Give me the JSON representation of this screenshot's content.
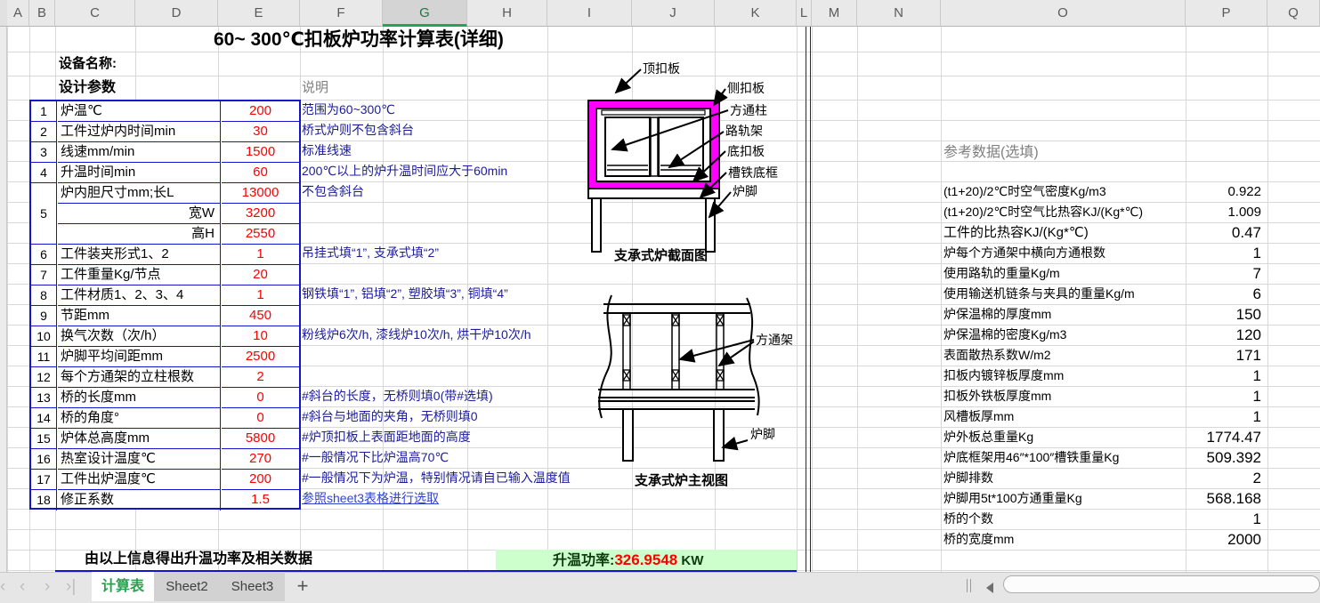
{
  "columns": [
    "A",
    "B",
    "C",
    "D",
    "E",
    "F",
    "G",
    "H",
    "I",
    "J",
    "K",
    "L",
    "M",
    "N",
    "O",
    "P",
    "Q"
  ],
  "selected_column": "G",
  "title": "60~ 300℃扣板炉功率计算表(详细)",
  "device_name_label": "设备名称:",
  "design_params_label": "设计参数",
  "desc_header": "说明",
  "params": {
    "rows": [
      {
        "num": "1",
        "label": "炉温℃",
        "value": "200",
        "desc": "范围为60~300℃"
      },
      {
        "num": "2",
        "label": "工件过炉内时间min",
        "value": "30",
        "desc": "桥式炉则不包含斜台"
      },
      {
        "num": "3",
        "label": "线速mm/min",
        "value": "1500",
        "desc": "标准线速"
      },
      {
        "num": "4",
        "label": "升温时间min",
        "value": "60",
        "desc": "200℃以上的炉升温时间应大于60min"
      },
      {
        "num": "5",
        "label": "炉内胆尺寸mm;长L",
        "value": "13000",
        "desc": "不包含斜台"
      },
      {
        "label": "宽W",
        "value": "3200"
      },
      {
        "label": "高H",
        "value": "2550"
      },
      {
        "num": "6",
        "label": "工件装夹形式1、2",
        "value": "1",
        "desc": "吊挂式填“1”, 支承式填“2”"
      },
      {
        "num": "7",
        "label": "工件重量Kg/节点",
        "value": "20",
        "desc": ""
      },
      {
        "num": "8",
        "label": "工件材质1、2、3、4",
        "value": "1",
        "desc": "钢铁填“1”, 铝填“2”, 塑胶填“3”, 铜填“4”"
      },
      {
        "num": "9",
        "label": "节距mm",
        "value": "450",
        "desc": ""
      },
      {
        "num": "10",
        "label": "换气次数（次/h）",
        "value": "10",
        "desc": "粉线炉6次/h, 漆线炉10次/h, 烘干炉10次/h"
      },
      {
        "num": "11",
        "label": "炉脚平均间距mm",
        "value": "2500",
        "desc": ""
      },
      {
        "num": "12",
        "label": "每个方通架的立柱根数",
        "value": "2",
        "desc": ""
      },
      {
        "num": "13",
        "label": "桥的长度mm",
        "value": "0",
        "desc": "#斜台的长度，无桥则填0(带#选填)"
      },
      {
        "num": "14",
        "label": "桥的角度°",
        "value": "0",
        "desc": "#斜台与地面的夹角，无桥则填0"
      },
      {
        "num": "15",
        "label": "炉体总高度mm",
        "value": "5800",
        "desc": "#炉顶扣板上表面距地面的高度"
      },
      {
        "num": "16",
        "label": "热室设计温度℃",
        "value": "270",
        "desc": "#一般情况下比炉温高70℃"
      },
      {
        "num": "17",
        "label": "工件出炉温度℃",
        "value": "200",
        "desc": "#一般情况下为炉温，特别情况请自已输入温度值"
      },
      {
        "num": "18",
        "label": "修正系数",
        "value": "1.5",
        "desc_link": "参照sheet3表格进行选取"
      }
    ]
  },
  "diagram1": {
    "caption": "支承式炉截面图",
    "labels": {
      "top_plate": "顶扣板",
      "side_plate": "侧扣板",
      "square_column": "方通柱",
      "rail_frame": "路轨架",
      "bottom_plate": "底扣板",
      "channel_base": "槽铁底框",
      "furnace_foot": "炉脚"
    }
  },
  "diagram2": {
    "caption": "支承式炉主视图",
    "labels": {
      "square_frame": "方通架",
      "furnace_foot": "炉脚"
    }
  },
  "reference": {
    "header": "参考数据(选填)",
    "rows": [
      {
        "label": "(t1+20)/2℃时空气密度Kg/m3",
        "value": "0.922"
      },
      {
        "label": "(t1+20)/2℃时空气比热容KJ/(Kg*℃)",
        "value": "1.009"
      },
      {
        "label": "工件的比热容KJ/(Kg*℃)",
        "value": "0.47"
      },
      {
        "label": "炉每个方通架中横向方通根数",
        "value": "1"
      },
      {
        "label": "使用路轨的重量Kg/m",
        "value": "7"
      },
      {
        "label": "使用输送机链条与夹具的重量Kg/m",
        "value": "6"
      },
      {
        "label": "炉保温棉的厚度mm",
        "value": "150"
      },
      {
        "label": "炉保温棉的密度Kg/m3",
        "value": "120"
      },
      {
        "label": "表面散热系数W/m2",
        "value": "171"
      },
      {
        "label": "扣板内镀锌板厚度mm",
        "value": "1"
      },
      {
        "label": "扣板外铁板厚度mm",
        "value": "1"
      },
      {
        "label": "风槽板厚mm",
        "value": "1"
      },
      {
        "label": "炉外板总重量Kg",
        "value": "1774.47"
      },
      {
        "label": "炉底框架用46″*100″槽铁重量Kg",
        "value": "509.392"
      },
      {
        "label": "炉脚排数",
        "value": "2"
      },
      {
        "label": "炉脚用5t*100方通重量Kg",
        "value": "568.168"
      },
      {
        "label": "桥的个数",
        "value": "1"
      },
      {
        "label": "桥的宽度mm",
        "value": "2000"
      }
    ]
  },
  "summary": {
    "text": "由以上信息得出升温功率及相关数据",
    "result_label": "升温功率:",
    "result_value": "326.9548",
    "result_unit": "KW"
  },
  "tabs": {
    "sheets": [
      {
        "label": "计算表",
        "active": true
      },
      {
        "label": "Sheet2",
        "active": false
      },
      {
        "label": "Sheet3",
        "active": false
      }
    ],
    "add": "+"
  },
  "colors": {
    "accent_green": "#217346",
    "tab_active_green": "#2f9e4f",
    "value_red": "#fe0000",
    "table_border_blue": "#1414cc",
    "desc_navy": "#1c1c99",
    "hyperlink_blue": "#3344cc",
    "diagram_magenta": "#ff00ff",
    "result_bg_green": "#ccffcc"
  }
}
